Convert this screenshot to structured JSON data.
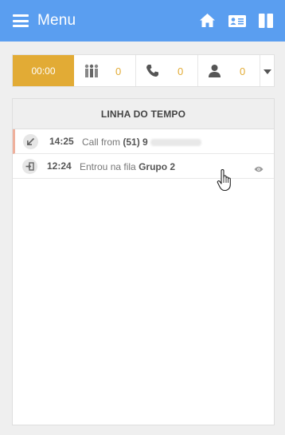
{
  "topbar": {
    "menu_label": "Menu",
    "icons": [
      "home-icon",
      "contact-card-icon",
      "columns-icon"
    ]
  },
  "status": {
    "timer": "00:00",
    "counters": [
      {
        "icon": "queue-people-icon",
        "value": "0"
      },
      {
        "icon": "phone-icon",
        "value": "0"
      },
      {
        "icon": "agent-icon",
        "value": "0"
      }
    ]
  },
  "timeline": {
    "title": "LINHA DO TEMPO",
    "entries": [
      {
        "icon": "incoming-call-icon",
        "time": "14:25",
        "text": "Call from",
        "bold": "(51) 9"
      },
      {
        "icon": "enter-queue-icon",
        "time": "12:24",
        "text": "Entrou na fila",
        "bold": "Grupo 2"
      }
    ]
  },
  "colors": {
    "header_blue": "#5a9ef0",
    "accent_gold": "#e2ab35",
    "highlight_border": "#efb09c"
  }
}
